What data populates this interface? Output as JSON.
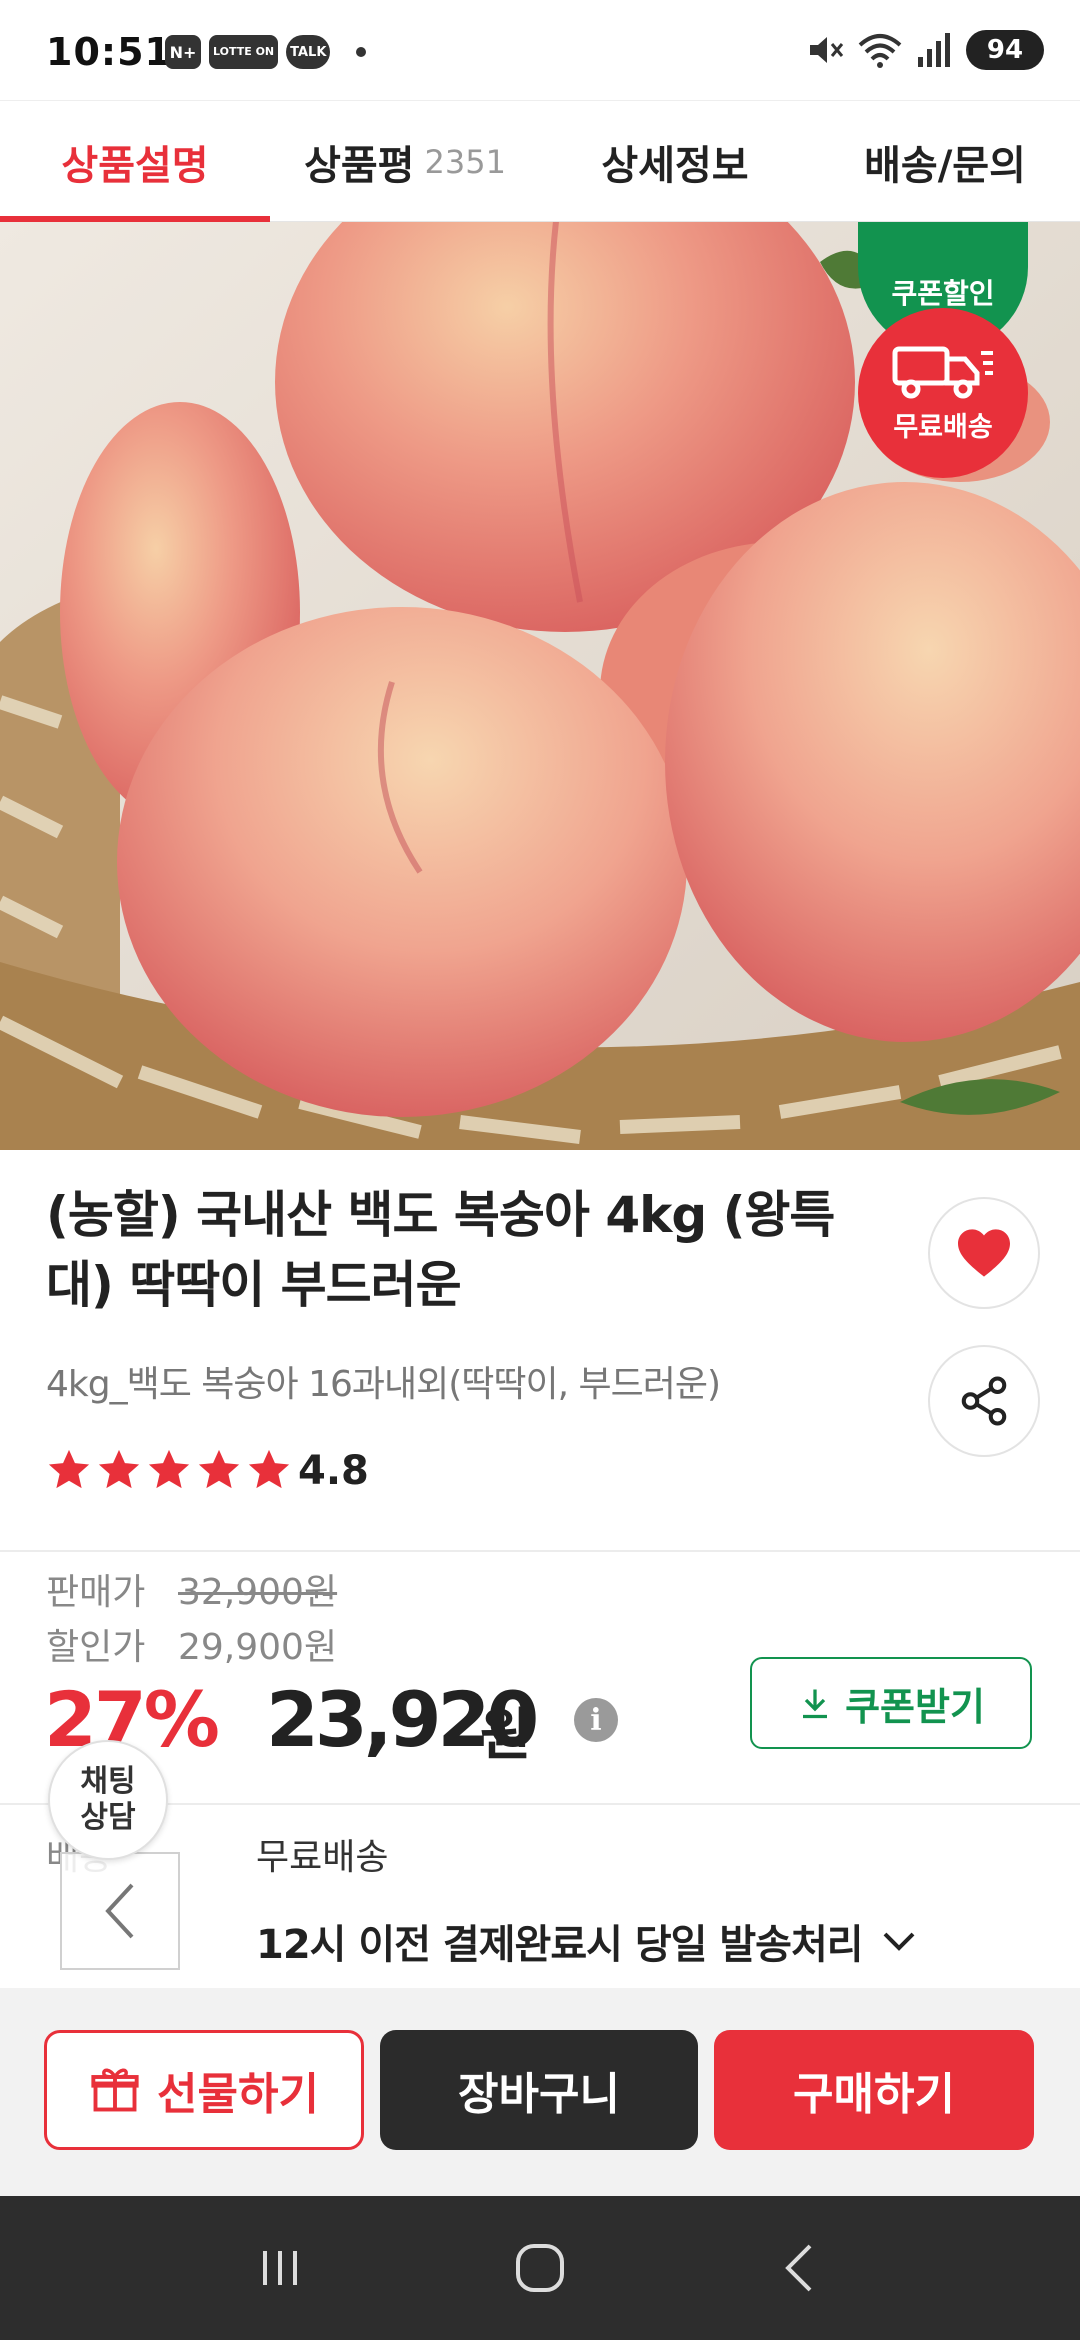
{
  "status_bar": {
    "time": "10:51",
    "app_icons": [
      "N+",
      "LOTTE ON",
      "TALK"
    ],
    "battery": "94"
  },
  "tabs": [
    {
      "label": "상품설명"
    },
    {
      "label": "상품평",
      "count": "2351"
    },
    {
      "label": "상세정보"
    },
    {
      "label": "배송/문의"
    }
  ],
  "hero": {
    "coupon_badge": "쿠폰할인",
    "shipping_badge": "무료배송"
  },
  "product": {
    "title": "(농할) 국내산 백도 복숭아 4kg (왕특대) 딱딱이 부드러운",
    "option": "4kg_백도 복숭아 16과내외(딱딱이, 부드러운)",
    "rating": "4.8",
    "rating_stars": 4.8
  },
  "price": {
    "sale_label": "판매가",
    "sale_price": "32,900원",
    "discount_label": "할인가",
    "discount_price": "29,900원",
    "discount_rate": "27%",
    "final_price": "23,920",
    "final_unit": "원",
    "coupon_button": "쿠폰받기"
  },
  "shipping": {
    "label": "배송",
    "value": "무료배송",
    "note": "12시 이전 결제완료시 당일 발송처리"
  },
  "floating": {
    "chat_label": "채팅\n상담"
  },
  "actions": {
    "gift": "선물하기",
    "cart": "장바구니",
    "buy": "구매하기"
  },
  "colors": {
    "accent_red": "#e8303a",
    "coupon_green": "#12934f"
  }
}
